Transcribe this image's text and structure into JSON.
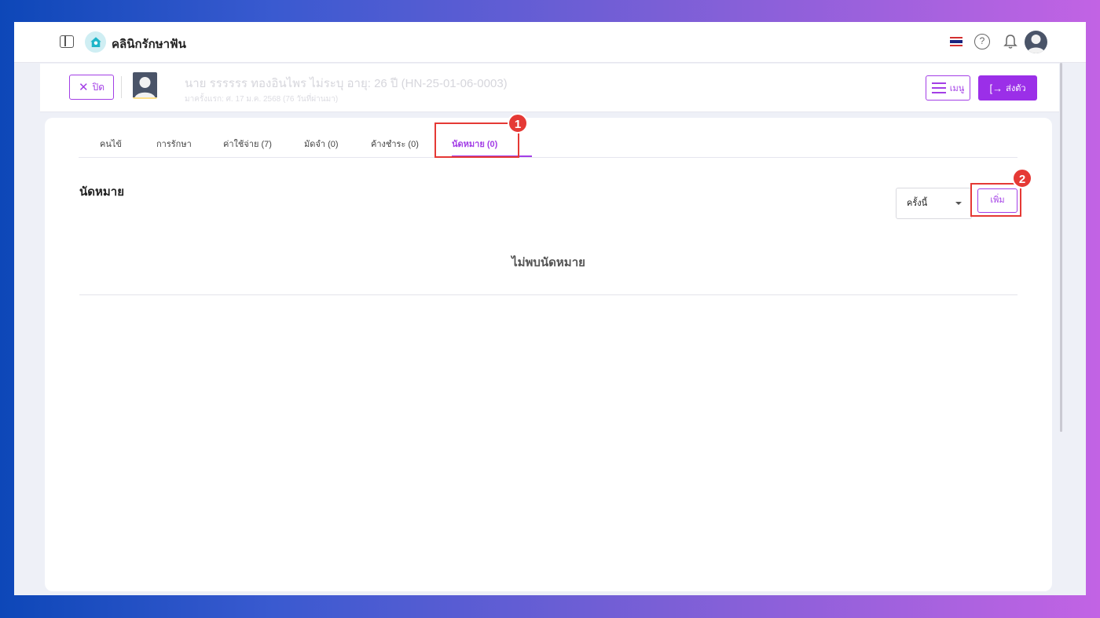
{
  "app": {
    "title": "คลินิกรักษาฟัน",
    "colors": {
      "accent": "#a33ee6",
      "accent_solid": "#9b2fe8",
      "highlight": "#e53935"
    }
  },
  "topbar": {
    "sidebar_toggle_icon": "sidebar-toggle-icon",
    "logo_icon": "home-icon",
    "language_flag_icon": "thai-flag-icon",
    "help_icon": "help-icon",
    "help_glyph": "?",
    "notification_icon": "bell-icon",
    "profile_icon": "avatar-icon"
  },
  "patient_bar": {
    "close_label": "ปิด",
    "close_glyph": "✕",
    "patient_name": "นาย รรรรรร ทองอินไพร ไม่ระบุ อายุ: 26 ปี (HN-25-01-06-0003)",
    "patient_sub": "มาครั้งแรก: ศ. 17 ม.ค. 2568 (76 วันที่ผ่านมา)",
    "menu_label": "เมนู",
    "checkin_label": "ส่งตัว",
    "checkin_glyph": "[→"
  },
  "tabs": [
    {
      "label": "คนไข้"
    },
    {
      "label": "การรักษา"
    },
    {
      "label": "ค่าใช้จ่าย (7)"
    },
    {
      "label": "มัดจำ (0)"
    },
    {
      "label": "ค้างชำระ (0)"
    },
    {
      "label": "นัดหมาย (0)",
      "active": true
    }
  ],
  "appointments": {
    "title": "นัดหมาย",
    "filter_selected": "ครั้งนี้",
    "add_label": "เพิ่ม",
    "empty_text": "ไม่พบนัดหมาย"
  },
  "annotations": [
    {
      "number": "1"
    },
    {
      "number": "2"
    }
  ]
}
